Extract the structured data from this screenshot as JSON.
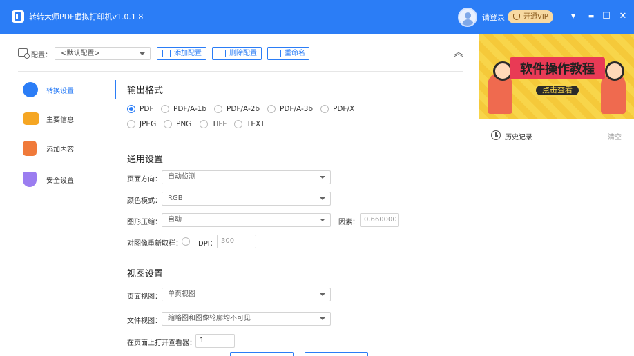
{
  "titlebar": {
    "title": "转转大师PDF虚拟打印机v1.0.1.8",
    "login": "请登录",
    "vip": "开通VIP",
    "menu_icon": "▾",
    "minimize_icon": "▬",
    "maximize_icon": "☐",
    "close_icon": "✕"
  },
  "toolbar": {
    "config_label": "配置：",
    "config_value": "<默认配置>",
    "add_config": "添加配置",
    "delete_config": "删除配置",
    "rename": "重命名",
    "collapse_icon": "︽"
  },
  "nav": {
    "items": [
      {
        "label": "转换设置",
        "icon": "convert-icon",
        "color": "#2b7df6"
      },
      {
        "label": "主要信息",
        "icon": "folder-icon",
        "color": "#f5a623"
      },
      {
        "label": "添加内容",
        "icon": "add-doc-icon",
        "color": "#f07a3a"
      },
      {
        "label": "安全设置",
        "icon": "shield-icon",
        "color": "#9b7df0"
      }
    ]
  },
  "output_format": {
    "title": "输出格式",
    "options": [
      "PDF",
      "PDF/A-1b",
      "PDF/A-2b",
      "PDF/A-3b",
      "PDF/X",
      "JPEG",
      "PNG",
      "TIFF",
      "TEXT"
    ],
    "selected": "PDF"
  },
  "general": {
    "title": "通用设置",
    "page_direction_label": "页面方向：",
    "page_direction_value": "自动侦测",
    "color_mode_label": "颜色模式：",
    "color_mode_value": "RGB",
    "compression_label": "图形压缩：",
    "compression_value": "自动",
    "factor_label": "因素：",
    "factor_value": "0.660000",
    "resample_label": "对图像重新取样：",
    "dpi_label": "DPI：",
    "dpi_value": "300"
  },
  "view": {
    "title": "视图设置",
    "page_view_label": "页面视图：",
    "page_view_value": "单页视图",
    "doc_view_label": "文件视图：",
    "doc_view_value": "缩略图和图像轮廓均不可见",
    "open_page_label": "在页面上打开查看器：",
    "open_page_value": "1"
  },
  "banner": {
    "title": "软件操作教程",
    "cta": "点击查看"
  },
  "history": {
    "label": "历史记录",
    "clear": "清空"
  },
  "colors": {
    "accent": "#2b7df6",
    "vip_bg": "#f7d9a2",
    "banner_bg": "#f8d54a"
  }
}
